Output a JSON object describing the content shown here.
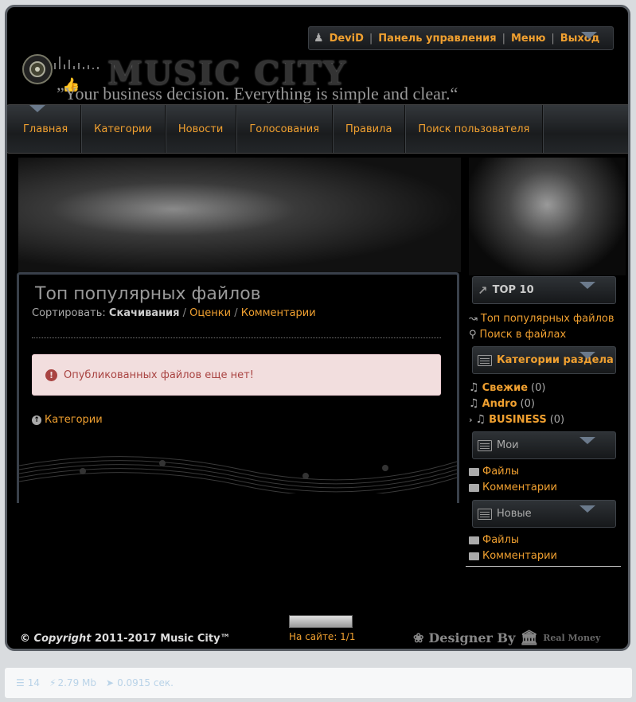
{
  "userbar": {
    "username": "DeviD",
    "items": [
      "Панель управления",
      "Меню",
      "Выход"
    ]
  },
  "logo": {
    "title": "MUSIC  CITY",
    "slogan": "”Your business decision. Everything is simple and clear.“"
  },
  "nav": [
    "Главная",
    "Категории",
    "Новости",
    "Голосования",
    "Правила",
    "Поиск пользователя"
  ],
  "main": {
    "title": "Топ популярных файлов",
    "sort_label": "Сортировать:",
    "sort_active": "Скачивания",
    "sort_links": [
      "Оценки",
      "Комментарии"
    ],
    "alert": "Опубликованных файлов еще нет!",
    "category_link": "Категории"
  },
  "sidebar": {
    "top10_title": "TOP 10",
    "top_links": [
      "Топ популярных файлов",
      "Поиск в файлах"
    ],
    "categories_title": "Категории раздела",
    "categories": [
      {
        "name": "Свежие",
        "count": "(0)"
      },
      {
        "name": "Andro",
        "count": "(0)"
      },
      {
        "name": "BUSINESS",
        "count": "(0)"
      }
    ],
    "mine_title": "Мои",
    "mine_links": [
      "Файлы",
      "Комментарии"
    ],
    "new_title": "Новые",
    "new_links": [
      "Файлы",
      "Комментарии"
    ]
  },
  "footer": {
    "copyright": "© Copyright",
    "years": "2011-2017 Music City™",
    "online": "На сайте: 1/1",
    "designer": "Designer By",
    "designer_brand": "Real Money"
  },
  "statusbar": {
    "queries": "14",
    "memory": "2.79 Mb",
    "time": "0.0915 сек."
  }
}
